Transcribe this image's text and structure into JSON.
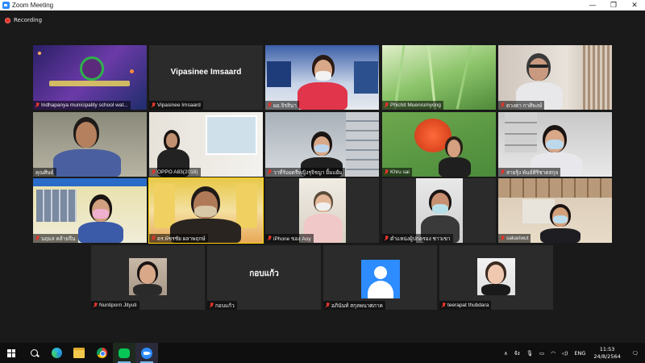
{
  "window": {
    "title": "Zoom Meeting"
  },
  "recording": {
    "label": "Recording"
  },
  "tiles": [
    {
      "name": "Indhapanya municipality school wat...",
      "muted": true,
      "video": true
    },
    {
      "name": "Vipasinee Imsaard",
      "muted": true,
      "video": false,
      "display_name": "Vipasinee Imsaard"
    },
    {
      "name": "ผอ.จิรสินา",
      "muted": true,
      "video": true
    },
    {
      "name": "Phichit Muenrumyong",
      "muted": true,
      "video": true
    },
    {
      "name": "ดวงตา กาศิพงษ์",
      "muted": true,
      "video": true
    },
    {
      "name": "คุณศิษย์",
      "muted": false,
      "video": true
    },
    {
      "name": "OPPO A83(2018)",
      "muted": true,
      "video": true
    },
    {
      "name": "วาที่ร้อยตรีหญิงรุจิรญา ยิ้มแย้ม",
      "muted": true,
      "video": true
    },
    {
      "name": "Khru sai",
      "muted": true,
      "video": true
    },
    {
      "name": "สายรุ้ง พันธ์ศิริชาตสกุล",
      "muted": true,
      "video": true
    },
    {
      "name": "นฤมล คล้ายจีน",
      "muted": true,
      "video": true
    },
    {
      "name": "ดร.พัชรชัย ผลาพฤกษ์",
      "muted": true,
      "video": true,
      "active": true
    },
    {
      "name": "iPhone ของ Aoy",
      "muted": true,
      "video": true
    },
    {
      "name": "ตำแหน่งผู้ปกครอง ชาวเขา",
      "muted": true,
      "video": true
    },
    {
      "name": "sakariwut",
      "muted": true,
      "video": true
    },
    {
      "name": "Nuntiporn Jityuti",
      "muted": true,
      "video": true
    },
    {
      "name": "กอบแก้ว",
      "muted": true,
      "video": false,
      "display_name": "กอบแก้ว"
    },
    {
      "name": "อภินันท์ สกุลพนาศภาค",
      "muted": true,
      "video": false,
      "avatar": true
    },
    {
      "name": "teerapat thubdara",
      "muted": true,
      "video": true
    }
  ],
  "taskbar": {
    "apps": [
      "windows-start",
      "search",
      "edge",
      "file-explorer",
      "chrome",
      "line",
      "zoom"
    ],
    "tray": {
      "lang_short": "จัง",
      "lang": "ENG",
      "time": "11:53",
      "date": "24/8/2564"
    }
  },
  "colors": {
    "zoom_blue": "#2D8CFF",
    "active_speaker": "#FFD400",
    "muted_red": "#E0352B"
  }
}
